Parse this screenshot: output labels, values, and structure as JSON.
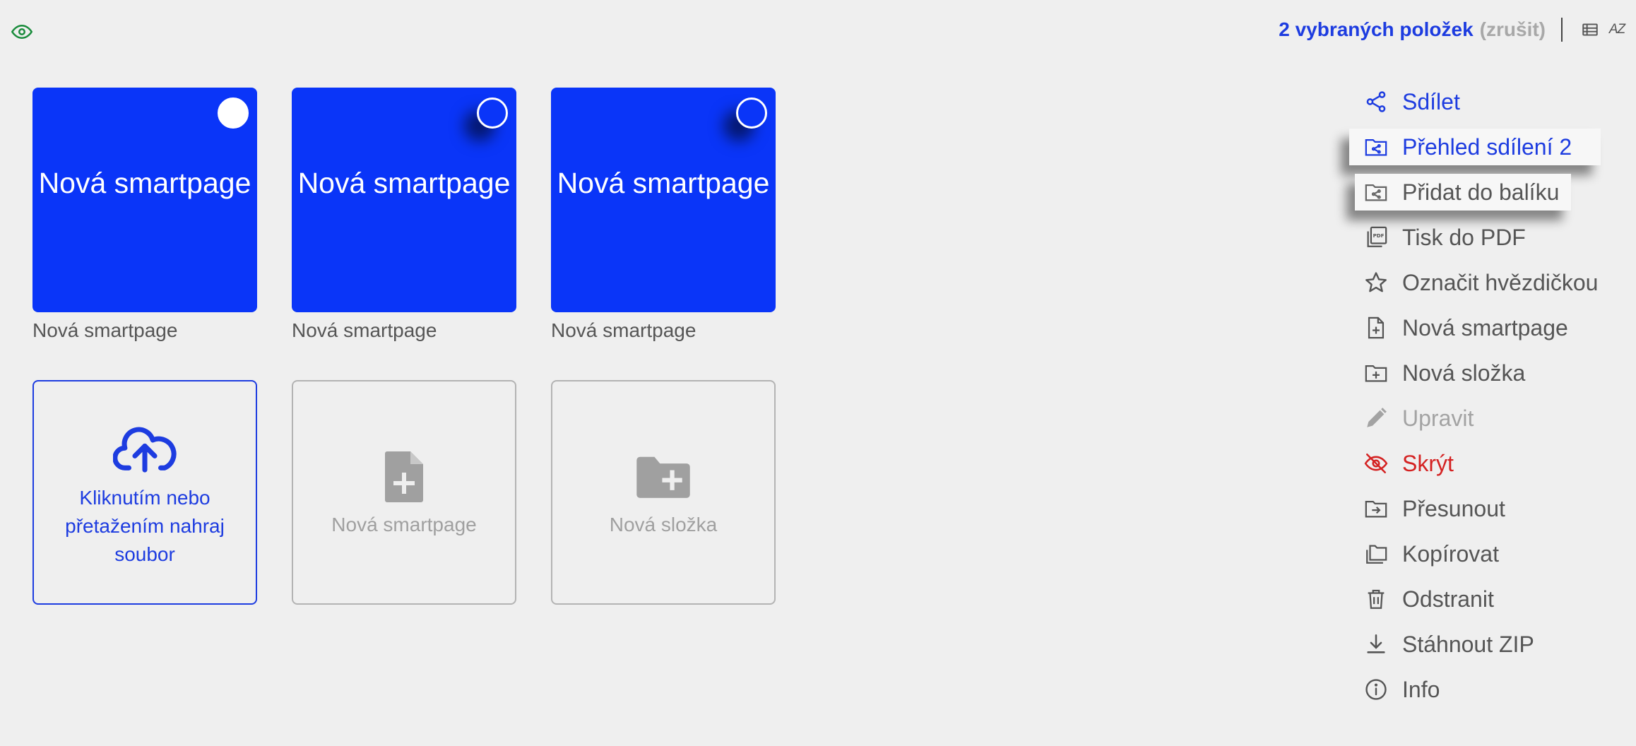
{
  "colors": {
    "accent": "#1d3ce0",
    "tile_blue": "#0a35f8",
    "danger": "#d42222",
    "visibility_icon": "#1a8c3c"
  },
  "topbar": {
    "selection_text": "2 vybraných položek",
    "cancel_text": "(zrušit)",
    "list_view_icon": "list-icon",
    "sort_label": "AZ"
  },
  "items": [
    {
      "title": "Nová smartpage",
      "caption": "Nová smartpage"
    },
    {
      "title": "Nová smartpage",
      "caption": "Nová smartpage"
    },
    {
      "title": "Nová smartpage",
      "caption": "Nová smartpage"
    }
  ],
  "actions": {
    "upload_line1": "Kliknutím nebo",
    "upload_line2": "přetažením nahraj",
    "upload_line3": "soubor",
    "new_smartpage": "Nová smartpage",
    "new_folder": "Nová složka"
  },
  "menu": [
    {
      "label": "Sdílet",
      "icon": "share-icon"
    },
    {
      "label": "Přehled sdílení 2",
      "icon": "folder-share-icon"
    },
    {
      "label": "Přidat do balíku",
      "icon": "folder-share-icon"
    },
    {
      "label": "Tisk do PDF",
      "icon": "pdf-icon"
    },
    {
      "label": "Označit hvězdičkou",
      "icon": "star-icon"
    },
    {
      "label": "Nová smartpage",
      "icon": "file-plus-icon"
    },
    {
      "label": "Nová složka",
      "icon": "folder-plus-icon"
    },
    {
      "label": "Upravit",
      "icon": "pencil-icon"
    },
    {
      "label": "Skrýt",
      "icon": "eye-off-icon"
    },
    {
      "label": "Přesunout",
      "icon": "folder-move-icon"
    },
    {
      "label": "Kopírovat",
      "icon": "copy-icon"
    },
    {
      "label": "Odstranit",
      "icon": "trash-icon"
    },
    {
      "label": "Stáhnout ZIP",
      "icon": "download-icon"
    },
    {
      "label": "Info",
      "icon": "info-icon"
    }
  ]
}
